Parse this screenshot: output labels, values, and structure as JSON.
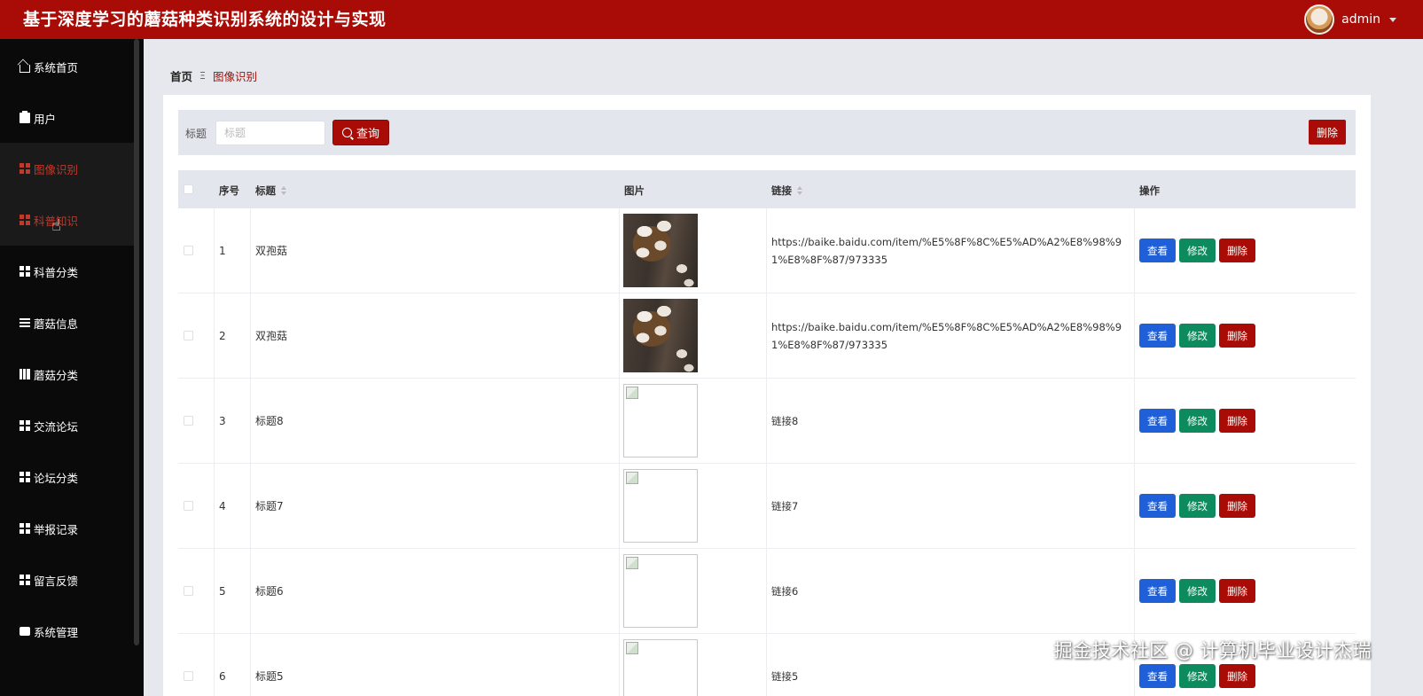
{
  "header": {
    "title": "基于深度学习的蘑菇种类识别系统的设计与实现",
    "user_name": "admin"
  },
  "sidebar": {
    "items": [
      {
        "label": "系统首页",
        "icon": "home-icon"
      },
      {
        "label": "用户",
        "icon": "clipboard-icon"
      },
      {
        "label": "图像识别",
        "icon": "grid-icon"
      },
      {
        "label": "科普知识",
        "icon": "grid-icon"
      },
      {
        "label": "科普分类",
        "icon": "grid-icon"
      },
      {
        "label": "蘑菇信息",
        "icon": "list-icon"
      },
      {
        "label": "蘑菇分类",
        "icon": "book-icon"
      },
      {
        "label": "交流论坛",
        "icon": "grid-icon"
      },
      {
        "label": "论坛分类",
        "icon": "grid-icon"
      },
      {
        "label": "举报记录",
        "icon": "grid-icon"
      },
      {
        "label": "留言反馈",
        "icon": "grid-icon"
      },
      {
        "label": "系统管理",
        "icon": "storage-icon"
      }
    ]
  },
  "breadcrumb": {
    "home": "首页",
    "separator": "Ξ",
    "current": "图像识别"
  },
  "search": {
    "label": "标题",
    "placeholder": "标题",
    "value": "",
    "query_button": "查询",
    "delete_button": "删除"
  },
  "table": {
    "columns": {
      "index": "序号",
      "title": "标题",
      "image": "图片",
      "link": "链接",
      "actions": "操作"
    },
    "actions": {
      "view": "查看",
      "edit": "修改",
      "delete": "删除"
    },
    "rows": [
      {
        "index": "1",
        "title": "双孢菇",
        "image": "photo",
        "link": "https://baike.baidu.com/item/%E5%8F%8C%E5%AD%A2%E8%98%91%E8%8F%87/973335"
      },
      {
        "index": "2",
        "title": "双孢菇",
        "image": "photo",
        "link": "https://baike.baidu.com/item/%E5%8F%8C%E5%AD%A2%E8%98%91%E8%8F%87/973335"
      },
      {
        "index": "3",
        "title": "标题8",
        "image": "broken",
        "link": "链接8"
      },
      {
        "index": "4",
        "title": "标题7",
        "image": "broken",
        "link": "链接7"
      },
      {
        "index": "5",
        "title": "标题6",
        "image": "broken",
        "link": "链接6"
      },
      {
        "index": "6",
        "title": "标题5",
        "image": "broken",
        "link": "链接5"
      }
    ]
  },
  "watermark": "掘金技术社区 @ 计算机毕业设计杰瑞",
  "colors": {
    "brand": "#a90c06",
    "view": "#1f5fd8",
    "edit": "#0e8a5f",
    "delete": "#a90c06",
    "sidebar": "#0a0a0a"
  }
}
